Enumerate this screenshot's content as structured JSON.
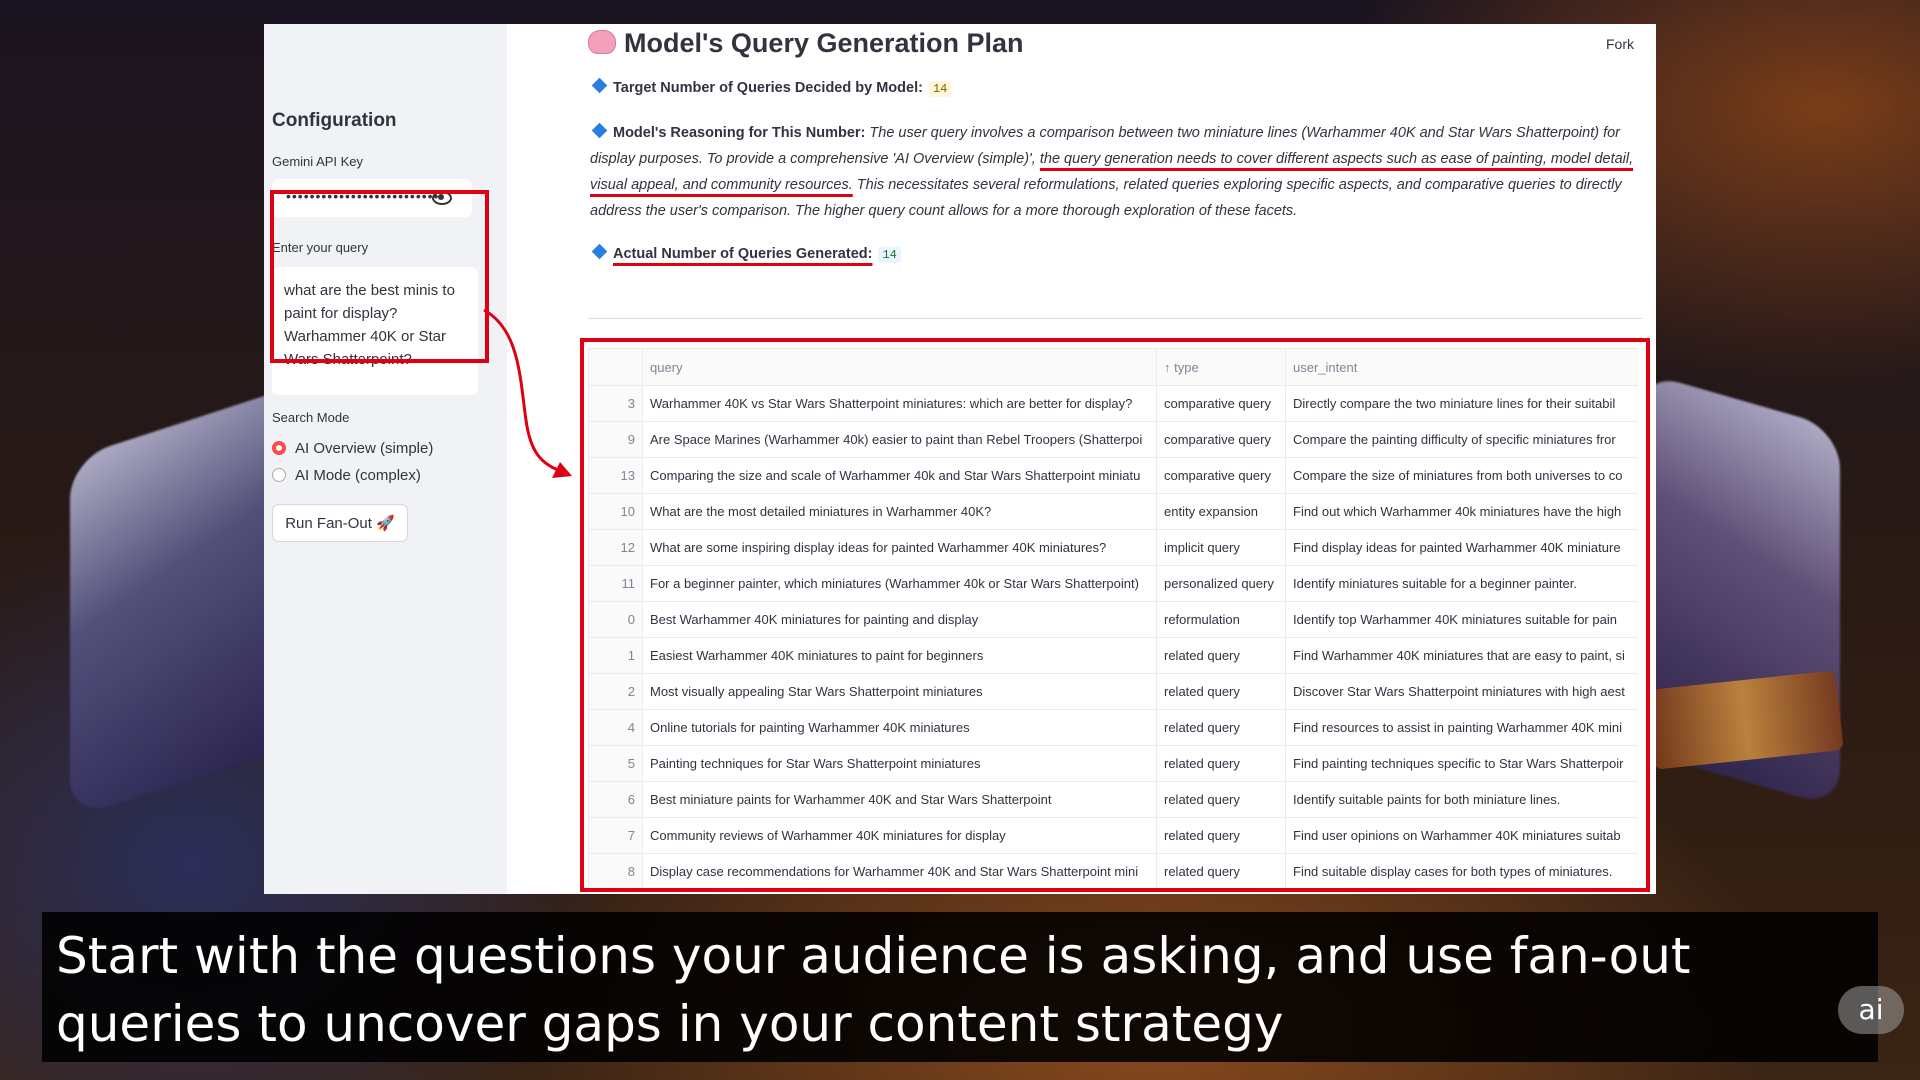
{
  "sidebar": {
    "title": "Configuration",
    "api_key_label": "Gemini API Key",
    "api_key_value": "••••••••••••••••••••••••••",
    "query_label": "Enter your query",
    "query_value": "what are the best minis to paint for display? Warhammer 40K or Star Wars Shatterpoint?",
    "search_mode_label": "Search Mode",
    "modes": [
      {
        "label": "AI Overview (simple)",
        "selected": true
      },
      {
        "label": "AI Mode (complex)",
        "selected": false
      }
    ],
    "run_button": "Run Fan-Out 🚀"
  },
  "main": {
    "title": "Model's Query Generation Plan",
    "fork": "Fork",
    "target_label": "Target Number of Queries Decided by Model:",
    "target_value": "14",
    "reasoning_label": "Model's Reasoning for This Number:",
    "reasoning_part1": "The user query involves a comparison between two miniature lines (Warhammer 40K and Star Wars Shatterpoint) for display purposes. To provide a comprehensive 'AI Overview (simple)', ",
    "reasoning_underlined": "the query generation needs to cover different aspects such as ease of painting, model detail, visual appeal, and community resources.",
    "reasoning_part2": " This necessitates several reformulations, related queries exploring specific aspects, and comparative queries to directly address the user's comparison. The higher query count allows for a more thorough exploration of these facets.",
    "actual_label": "Actual Number of Queries Generated:",
    "actual_value": "14"
  },
  "table": {
    "headers": [
      "",
      "query",
      "↑ type",
      "user_intent"
    ],
    "rows": [
      [
        "3",
        "Warhammer 40K vs Star Wars Shatterpoint miniatures: which are better for display?",
        "comparative query",
        "Directly compare the two miniature lines for their suitabil"
      ],
      [
        "9",
        "Are Space Marines (Warhammer 40k) easier to paint than Rebel Troopers (Shatterpoi",
        "comparative query",
        "Compare the painting difficulty of specific miniatures fror"
      ],
      [
        "13",
        "Comparing the size and scale of Warhammer 40k and Star Wars Shatterpoint miniatu",
        "comparative query",
        "Compare the size of miniatures from both universes to co"
      ],
      [
        "10",
        "What are the most detailed miniatures in Warhammer 40K?",
        "entity expansion",
        "Find out which Warhammer 40k miniatures have the high"
      ],
      [
        "12",
        "What are some inspiring display ideas for painted Warhammer 40K miniatures?",
        "implicit query",
        "Find display ideas for painted Warhammer 40K miniature"
      ],
      [
        "11",
        "For a beginner painter, which miniatures (Warhammer 40k or Star Wars Shatterpoint)",
        "personalized query",
        "Identify miniatures suitable for a beginner painter."
      ],
      [
        "0",
        "Best Warhammer 40K miniatures for painting and display",
        "reformulation",
        "Identify top Warhammer 40K miniatures suitable for pain"
      ],
      [
        "1",
        "Easiest Warhammer 40K miniatures to paint for beginners",
        "related query",
        "Find Warhammer 40K miniatures that are easy to paint, si"
      ],
      [
        "2",
        "Most visually appealing Star Wars Shatterpoint miniatures",
        "related query",
        "Discover Star Wars Shatterpoint miniatures with high aest"
      ],
      [
        "4",
        "Online tutorials for painting Warhammer 40K miniatures",
        "related query",
        "Find resources to assist in painting Warhammer 40K mini"
      ],
      [
        "5",
        "Painting techniques for Star Wars Shatterpoint miniatures",
        "related query",
        "Find painting techniques specific to Star Wars Shatterpoir"
      ],
      [
        "6",
        "Best miniature paints for Warhammer 40K and Star Wars Shatterpoint",
        "related query",
        "Identify suitable paints for both miniature lines."
      ],
      [
        "7",
        "Community reviews of Warhammer 40K miniatures for display",
        "related query",
        "Find user opinions on Warhammer 40K miniatures suitab"
      ],
      [
        "8",
        "Display case recommendations for Warhammer 40K and Star Wars Shatterpoint mini",
        "related query",
        "Find suitable display cases for both types of miniatures."
      ]
    ]
  },
  "caption": "Start with the questions your audience is asking, and use fan-out queries to uncover gaps in your content strategy",
  "ai_badge": "ai",
  "colors": {
    "highlight_red": "#e00014",
    "radio_accent": "#ff4b4b",
    "diamond_blue": "#2a7de1"
  },
  "icons": [
    "brain-icon",
    "eye-icon",
    "diamond-icon",
    "rocket-icon",
    "arrow-icon"
  ]
}
